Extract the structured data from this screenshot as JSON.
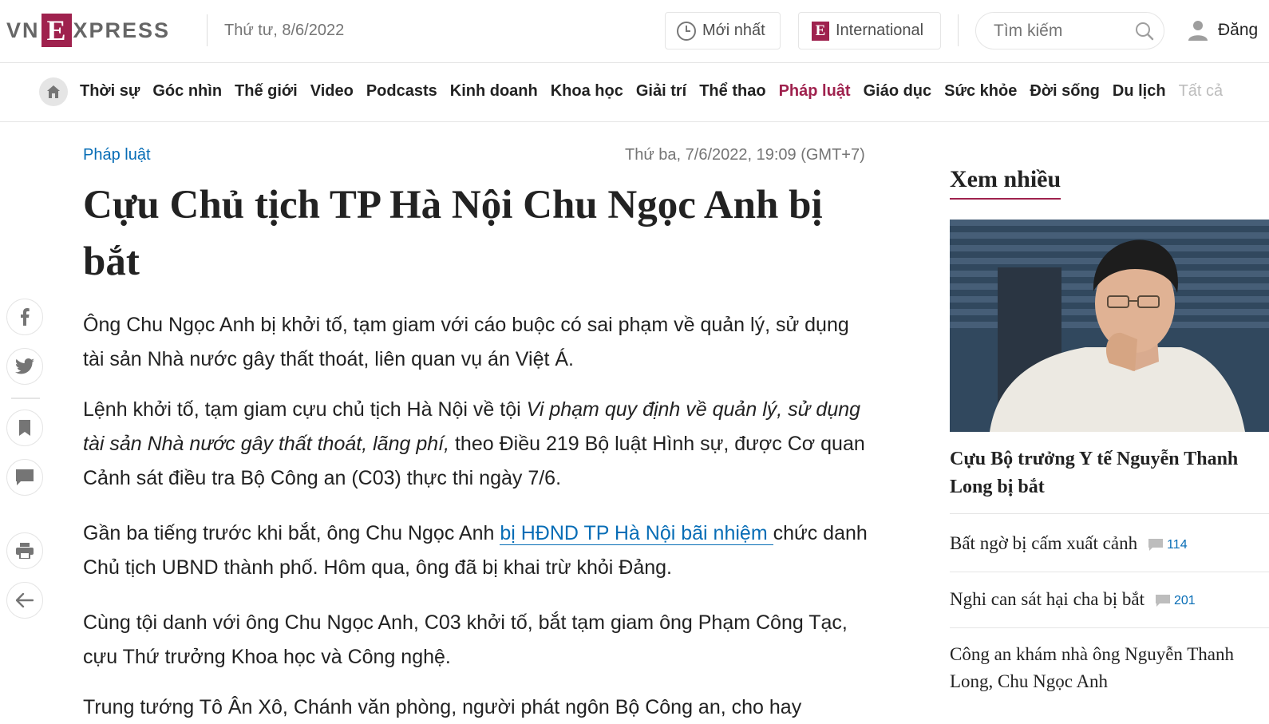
{
  "header": {
    "logo_left": "VN",
    "logo_e": "E",
    "logo_right": "XPRESS",
    "date": "Thứ tư, 8/6/2022",
    "newest_label": "Mới nhất",
    "international_label": "International",
    "search_placeholder": "Tìm kiếm",
    "login_label": "Đăng"
  },
  "nav": {
    "items": [
      "Thời sự",
      "Góc nhìn",
      "Thế giới",
      "Video",
      "Podcasts",
      "Kinh doanh",
      "Khoa học",
      "Giải trí",
      "Thể thao",
      "Pháp luật",
      "Giáo dục",
      "Sức khỏe",
      "Đời sống",
      "Du lịch"
    ],
    "active": "Pháp luật",
    "all_label": "Tất cả"
  },
  "article": {
    "category": "Pháp luật",
    "published": "Thứ ba, 7/6/2022, 19:09 (GMT+7)",
    "title": "Cựu Chủ tịch TP Hà Nội Chu Ngọc Anh bị bắt",
    "lead": "Ông Chu Ngọc Anh bị khởi tố, tạm giam với cáo buộc có sai phạm về quản lý, sử dụng tài sản Nhà nước gây thất thoát, liên quan vụ án Việt Á.",
    "p1_a": "Lệnh khởi tố, tạm giam cựu chủ tịch Hà Nội về tội ",
    "p1_em": "Vi phạm quy định về quản lý, sử dụng tài sản Nhà nước gây thất thoát, lãng phí,",
    "p1_b": " theo Điều 219 Bộ luật Hình sự, được Cơ quan Cảnh sát điều tra Bộ Công an (C03) thực thi ngày 7/6.",
    "p2_a": "Gần ba tiếng trước khi bắt, ông Chu Ngọc Anh ",
    "p2_link": "bị HĐND TP Hà Nội bãi nhiệm ",
    "p2_b": "chức danh Chủ tịch UBND thành phố. Hôm qua, ông đã bị khai trừ khỏi Đảng.",
    "p3": "Cùng tội danh với ông Chu Ngọc Anh, C03 khởi tố, bắt tạm giam ông Phạm Công Tạc, cựu Thứ trưởng Khoa học và Công nghệ.",
    "p4": "Trung tướng Tô Ân Xô, Chánh văn phòng, người phát ngôn Bộ Công an, cho hay"
  },
  "sidebar": {
    "title": "Xem nhiều",
    "lead_title": "Cựu Bộ trưởng Y tế Nguyễn Thanh Long bị bắt",
    "items": [
      {
        "title": "Bất ngờ bị cấm xuất cảnh",
        "comments": "114"
      },
      {
        "title": "Nghi can sát hại cha bị bắt",
        "comments": "201"
      },
      {
        "title": "Công an khám nhà ông Nguyễn Thanh Long, Chu Ngọc Anh",
        "comments": ""
      }
    ]
  },
  "colors": {
    "brand": "#9f224e",
    "link": "#076db6",
    "text": "#222222",
    "muted": "#757575"
  }
}
